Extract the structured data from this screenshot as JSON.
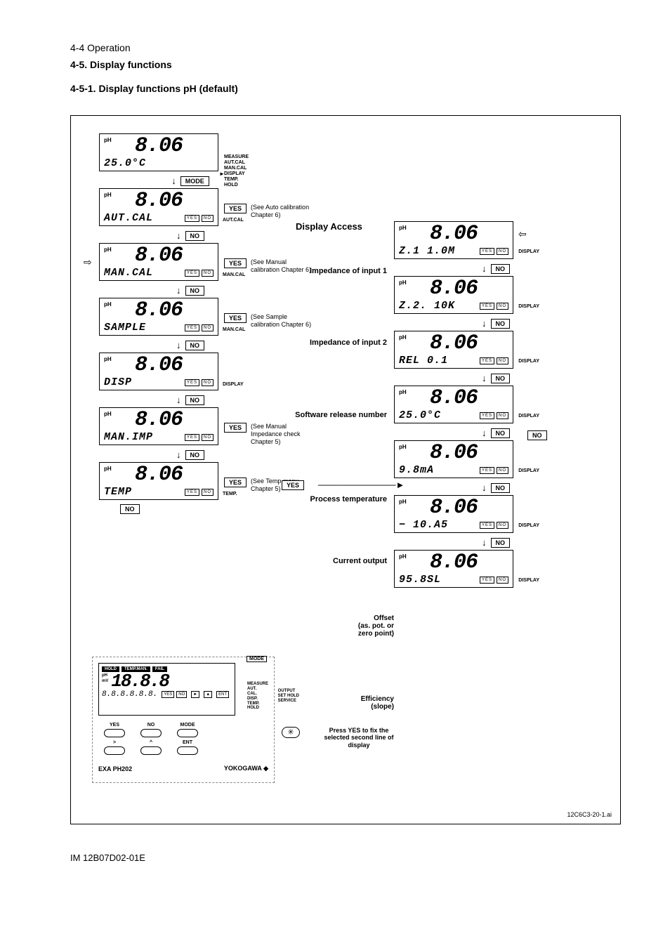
{
  "header": {
    "page_ref": "4-4 Operation"
  },
  "section45": "4-5. Display functions",
  "section451": "4-5-1. Display functions pH (default)",
  "lcd": {
    "big": "8.06",
    "temp_line": "25.0°C",
    "ph": "pH"
  },
  "side_menu": [
    "MEASURE",
    "AUT.CAL",
    "MAN.CAL",
    "DISPLAY",
    "TEMP.",
    "HOLD"
  ],
  "buttons": {
    "mode": "MODE",
    "yes": "YES",
    "no": "NO",
    "ent": "ENT"
  },
  "mini": {
    "yes": "YES",
    "no": "NO"
  },
  "left_nodes": [
    {
      "sub": "AUT.CAL",
      "tag": "AUT.CAL",
      "yes_annot": "(See Auto calibration Chapter 6)"
    },
    {
      "sub": "MAN.CAL",
      "tag": "MAN.CAL",
      "yes_annot": "(See Manual calibration Chapter 6)"
    },
    {
      "sub": "SAMPLE",
      "tag": "MAN.CAL",
      "yes_annot": "(See Sample calibration Chapter 6)"
    },
    {
      "sub": "DISP",
      "tag": "DISPLAY",
      "yes_annot": ""
    },
    {
      "sub": "MAN.IMP",
      "tag": "",
      "yes_annot": "(See Manual Impedance check Chapter 5)"
    },
    {
      "sub": "TEMP",
      "tag": "TEMP.",
      "yes_annot": "(See Temp menu Chapter 5)"
    }
  ],
  "heading_access": "Display Access",
  "mid_labels": {
    "imp1": "Impedance of input 1",
    "imp2": "Impedance of input 2",
    "rel": "Software release number",
    "ptemp": "Process temperature",
    "cout": "Current output",
    "offset1": "Offset",
    "offset2": "(as. pot. or",
    "offset3": "zero point)",
    "eff1": "Efficiency",
    "eff2": "(slope)"
  },
  "right_nodes": [
    {
      "sub": "Z.1   1.0M"
    },
    {
      "sub": "Z.2.  10K"
    },
    {
      "sub": "REL   0.1"
    },
    {
      "sub": "25.0°C"
    },
    {
      "sub": "9.8mA"
    },
    {
      "sub": "−  10.A5"
    },
    {
      "sub": "95.8SL"
    }
  ],
  "right_tag": "DISPLAY",
  "transmitter": {
    "top": [
      "HOLD",
      "TEMP.MAN.",
      "FAIL"
    ],
    "mode": "MODE",
    "ph": "pH",
    "mv": "mV",
    "big": "18.8.8",
    "sub": "8.8.8.8.8.8.",
    "side": [
      "MEASURE",
      "AUT.",
      "CAL.",
      "DISP.",
      "TEMP.",
      "HOLD"
    ],
    "side2": [
      "OUTPUT",
      "SET HOLD",
      "SERVICE"
    ],
    "btn_yes": "YES",
    "btn_no": "NO",
    "btn_mode": "MODE",
    "btn_gt": ">",
    "btn_up": "^",
    "btn_ent": "ENT",
    "brand_left": "EXA PH202",
    "brand_right": "YOKOGAWA ◆"
  },
  "fix_note": "Press YES to fix the selected second line of display",
  "diagram_id": "12C6C3-20-1.ai",
  "footer": "IM 12B07D02-01E"
}
